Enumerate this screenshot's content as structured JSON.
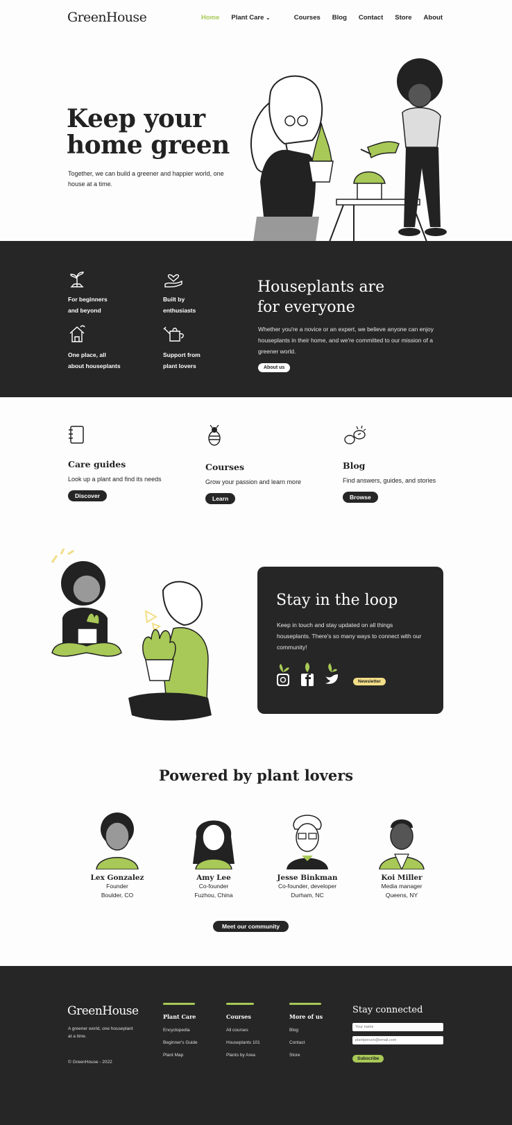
{
  "nav": {
    "logo": "GreenHouse",
    "links": [
      {
        "label": "Home",
        "active": true
      },
      {
        "label": "Plant Care",
        "dropdown": true
      },
      {
        "label": "Courses"
      },
      {
        "label": "Blog"
      },
      {
        "label": "Contact"
      },
      {
        "label": "Store"
      },
      {
        "label": "About"
      }
    ]
  },
  "hero": {
    "title_line1": "Keep your",
    "title_line2": "home green",
    "subtitle": "Together, we can build a greener and happier world, one house at a time."
  },
  "features": {
    "items": [
      {
        "icon": "sprout-icon",
        "label_line1": "For beginners",
        "label_line2": "and beyond"
      },
      {
        "icon": "heart-hand-icon",
        "label_line1": "Built by",
        "label_line2": "enthusiasts"
      },
      {
        "icon": "house-plant-icon",
        "label_line1": "One place, all",
        "label_line2": "about houseplants"
      },
      {
        "icon": "watering-can-icon",
        "label_line1": "Support from",
        "label_line2": "plant lovers"
      }
    ],
    "title_line1": "Houseplants are",
    "title_line2": "for everyone",
    "text": "Whether you're a novice or an expert, we believe anyone can enjoy houseplants in their home, and we're committed to our mission of a greener world.",
    "button": "About us"
  },
  "cards": [
    {
      "icon": "notebook-icon",
      "title": "Care guides",
      "text": "Look up a plant and find its needs",
      "button": "Discover"
    },
    {
      "icon": "bee-icon",
      "title": "Courses",
      "text": "Grow your passion and learn more",
      "button": "Learn"
    },
    {
      "icon": "chat-bubbles-icon",
      "title": "Blog",
      "text": "Find answers, guides, and stories",
      "button": "Browse"
    }
  ],
  "loop": {
    "title": "Stay in the loop",
    "text": "Keep in touch and stay updated on all things houseplants. There's so many ways to connect with our community!",
    "socials": [
      "instagram-icon",
      "facebook-icon",
      "twitter-icon"
    ],
    "button": "Newsletter"
  },
  "team": {
    "title": "Powered by plant lovers",
    "members": [
      {
        "name": "Lex Gonzalez",
        "role": "Founder",
        "location": "Boulder, CO"
      },
      {
        "name": "Amy Lee",
        "role": "Co-founder",
        "location": "Fuzhou, China"
      },
      {
        "name": "Jesse Binkman",
        "role": "Co-founder, developer",
        "location": "Durham, NC"
      },
      {
        "name": "Koi Miller",
        "role": "Media manager",
        "location": "Queens, NY"
      }
    ],
    "button": "Meet our community"
  },
  "footer": {
    "logo": "GreenHouse",
    "tagline": "A greener world, one houseplant at a time.",
    "copyright": "© GreenHouse - 2022",
    "columns": [
      {
        "title": "Plant Care",
        "links": [
          "Encyclopedia",
          "Beginner's Guide",
          "Plant Map"
        ]
      },
      {
        "title": "Courses",
        "links": [
          "All courses",
          "Houseplants 101",
          "Plants by Area"
        ]
      },
      {
        "title": "More of us",
        "links": [
          "Blog",
          "Contact",
          "Store"
        ]
      }
    ],
    "stay_title": "Stay connected",
    "name_placeholder": "Your name",
    "email_placeholder": "plantperson@email.com",
    "subscribe": "Subscribe"
  },
  "colors": {
    "accent": "#a8c957",
    "dark": "#262626",
    "yellow": "#f2de87"
  }
}
